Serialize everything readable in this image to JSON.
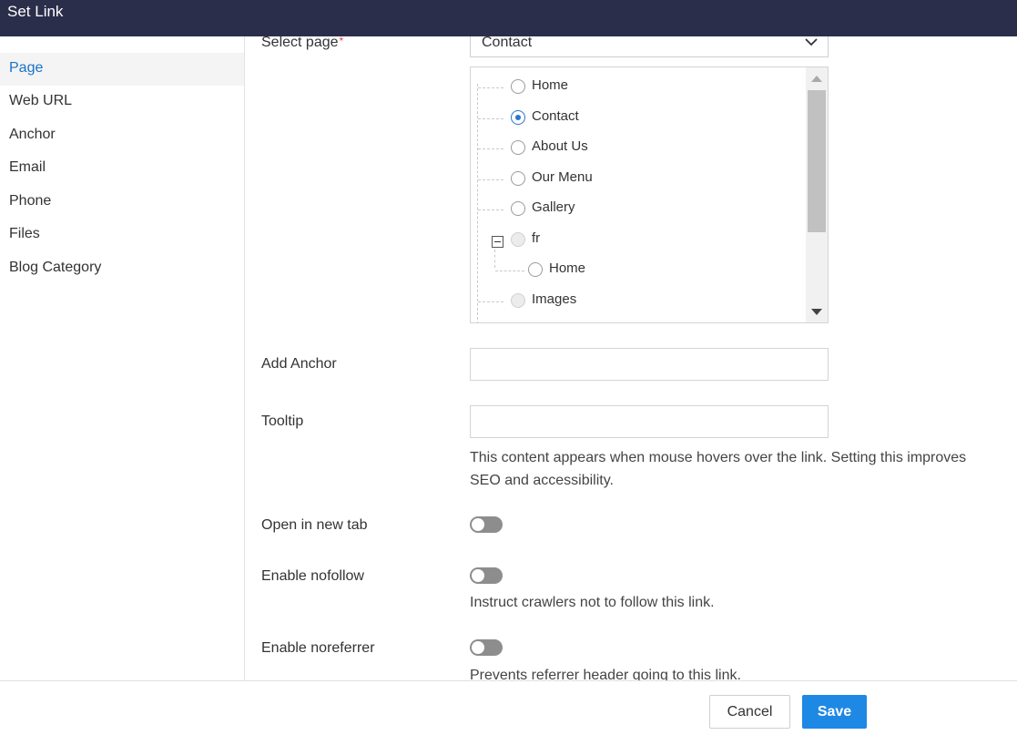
{
  "dialog": {
    "title": "Set Link"
  },
  "sidebar": {
    "items": [
      {
        "label": "Page",
        "active": true
      },
      {
        "label": "Web URL",
        "active": false
      },
      {
        "label": "Anchor",
        "active": false
      },
      {
        "label": "Email",
        "active": false
      },
      {
        "label": "Phone",
        "active": false
      },
      {
        "label": "Files",
        "active": false
      },
      {
        "label": "Blog Category",
        "active": false
      }
    ]
  },
  "form": {
    "select_page": {
      "label": "Select page",
      "required_mark": "*",
      "value": "Contact"
    },
    "page_tree": {
      "nodes": [
        {
          "label": "Home",
          "state": "unchecked",
          "level": 0
        },
        {
          "label": "Contact",
          "state": "checked",
          "level": 0
        },
        {
          "label": "About Us",
          "state": "unchecked",
          "level": 0
        },
        {
          "label": "Our Menu",
          "state": "unchecked",
          "level": 0
        },
        {
          "label": "Gallery",
          "state": "unchecked",
          "level": 0
        },
        {
          "label": "fr",
          "state": "disabled",
          "level": 0,
          "expanded": true
        },
        {
          "label": "Home",
          "state": "unchecked",
          "level": 1
        },
        {
          "label": "Images",
          "state": "disabled",
          "level": 0
        }
      ]
    },
    "add_anchor": {
      "label": "Add Anchor",
      "value": "",
      "placeholder": ""
    },
    "tooltip": {
      "label": "Tooltip",
      "value": "",
      "placeholder": "",
      "help_line1": "This content appears when mouse hovers over the link. Setting this improves",
      "help_line2": "SEO and accessibility."
    },
    "open_new_tab": {
      "label": "Open in new tab",
      "enabled": false
    },
    "nofollow": {
      "label": "Enable nofollow",
      "enabled": false,
      "help": "Instruct crawlers not to follow this link."
    },
    "noreferrer": {
      "label": "Enable noreferrer",
      "enabled": false,
      "help": "Prevents referrer header going to this link."
    }
  },
  "footer": {
    "cancel_label": "Cancel",
    "save_label": "Save"
  },
  "colors": {
    "titlebar": "#2b2e4a",
    "accent": "#1e88e5",
    "active_text": "#1a73c8",
    "toggle_off": "#8d8d8d"
  }
}
